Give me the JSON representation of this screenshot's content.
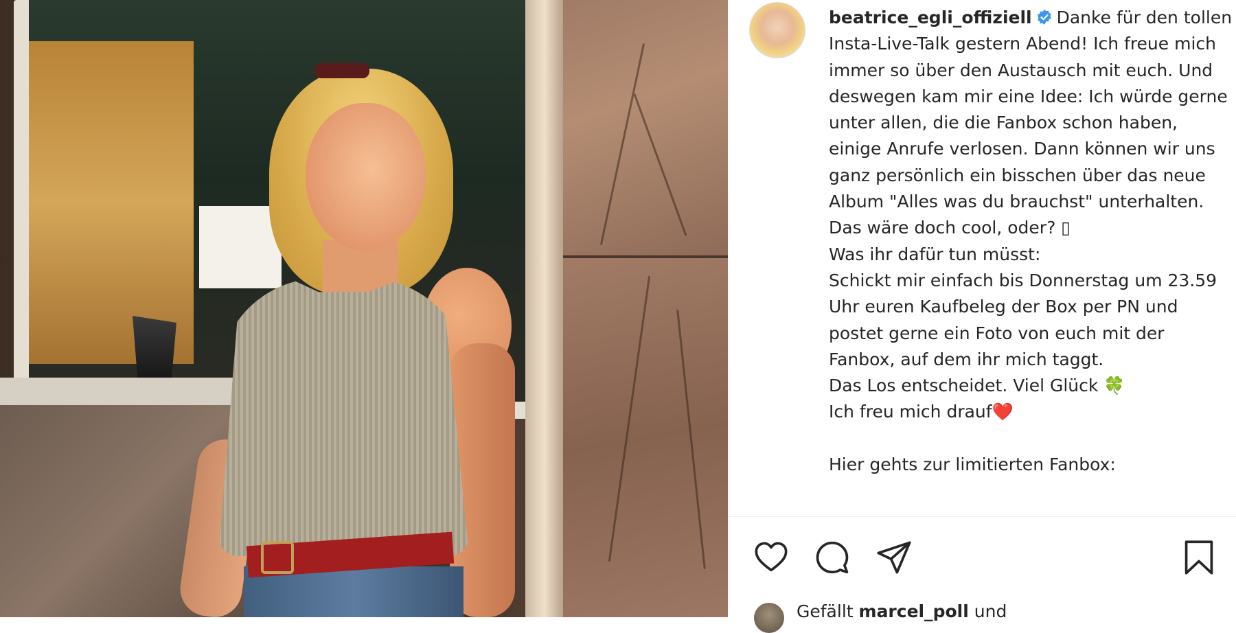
{
  "post": {
    "username": "beatrice_egli_offiziell",
    "caption_text": "Danke für den tollen Insta-Live-Talk gestern Abend! Ich freue mich immer so über den Austausch mit euch. Und deswegen kam mir eine Idee: Ich würde gerne unter allen, die die Fanbox schon haben, einige Anrufe verlosen. Dann können wir uns ganz persönlich ein bisschen über das neue Album \"Alles was du brauchst\" unterhalten. Das wäre doch cool, oder? ▯\nWas ihr dafür tun müsst:\nSchickt mir einfach bis Donnerstag um 23.59 Uhr euren Kaufbeleg der Box per PN und postet gerne ein Foto von euch mit der Fanbox, auf dem ihr mich taggt.\nDas Los entscheidet. Viel Glück 🍀\nIch freu mich drauf❤️\n\nHier gehts zur limitierten Fanbox:",
    "likes_prefix": "Gefällt ",
    "likes_user": "marcel_poll",
    "likes_suffix": " und"
  },
  "icons": {
    "verified": "verified-badge-icon",
    "like": "heart-icon",
    "comment": "comment-icon",
    "share": "paper-plane-icon",
    "save": "bookmark-icon"
  },
  "colors": {
    "verified_blue": "#3897f0",
    "text": "#262626",
    "divider": "#efefef"
  }
}
